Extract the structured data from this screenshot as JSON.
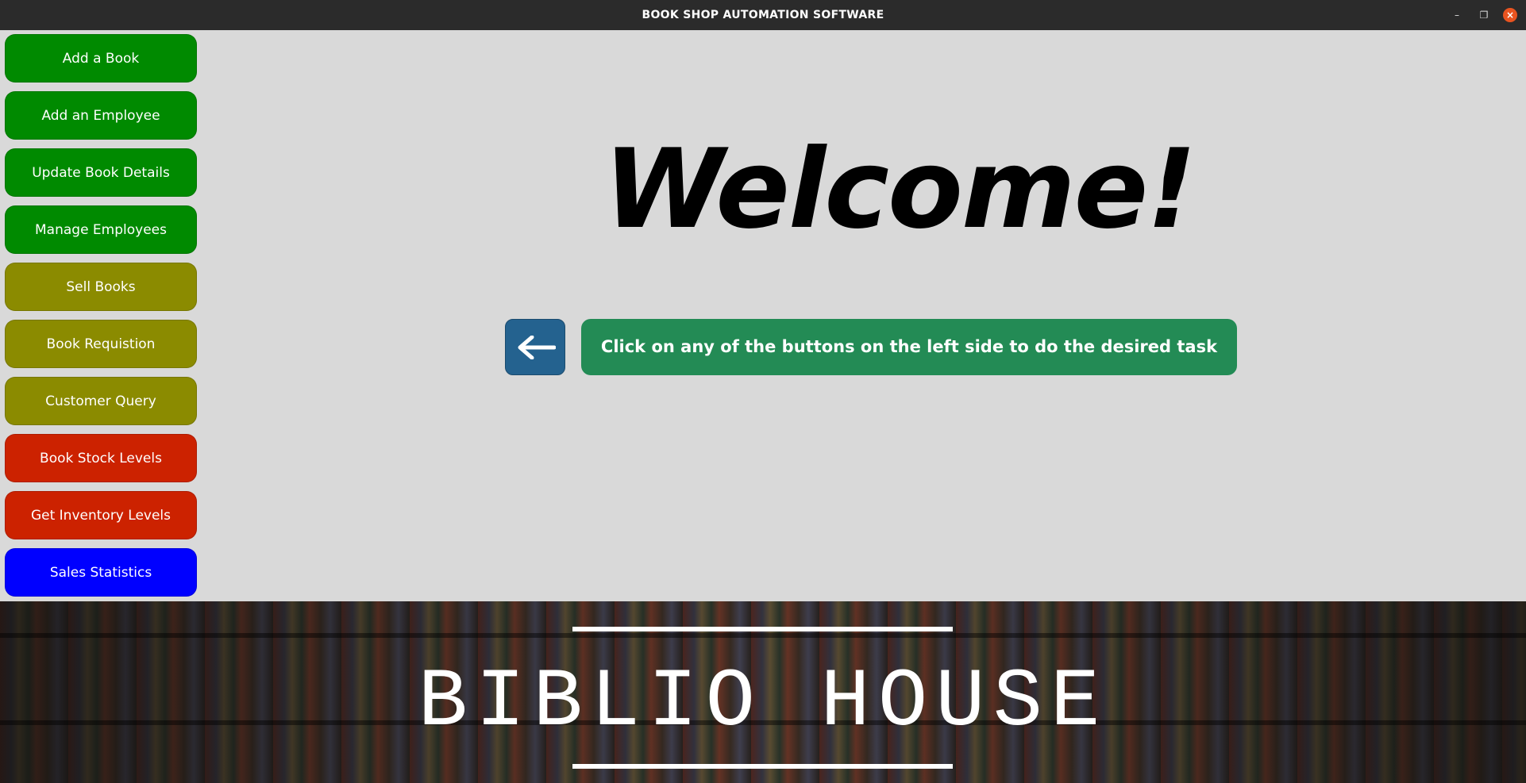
{
  "window": {
    "title": "BOOK SHOP AUTOMATION SOFTWARE"
  },
  "sidebar": {
    "items": [
      {
        "label": "Add a Book",
        "color": "#008a00"
      },
      {
        "label": "Add an Employee",
        "color": "#008a00"
      },
      {
        "label": "Update Book Details",
        "color": "#008a00"
      },
      {
        "label": "Manage Employees",
        "color": "#008a00"
      },
      {
        "label": "Sell Books",
        "color": "#8b8b00"
      },
      {
        "label": "Book Requistion",
        "color": "#8b8b00"
      },
      {
        "label": "Customer Query",
        "color": "#8b8b00"
      },
      {
        "label": "Book Stock Levels",
        "color": "#cc2200"
      },
      {
        "label": "Get Inventory Levels",
        "color": "#cc2200"
      },
      {
        "label": "Sales Statistics",
        "color": "#0000ff"
      }
    ]
  },
  "main": {
    "heading": "Welcome!",
    "back_icon": "left-arrow-icon",
    "hint": "Click on any of the buttons on the left side to do the desired task"
  },
  "footer": {
    "brand": "BIBLIO HOUSE"
  }
}
